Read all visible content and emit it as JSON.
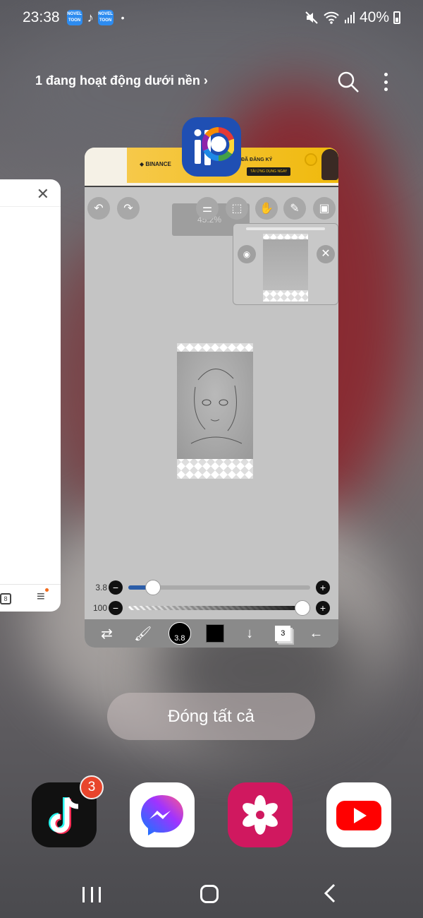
{
  "status_bar": {
    "time": "23:38",
    "notification_icons": [
      "noveltoon-icon",
      "tiktok-icon",
      "noveltoon-icon"
    ],
    "noveltoon_label": "NOVEL TOON",
    "overflow_dot": "•",
    "battery": "40%",
    "system_icons": [
      "mute-icon",
      "wifi-icon",
      "signal-icon",
      "battery-icon"
    ]
  },
  "header": {
    "background_activity": "1 đang hoạt động dưới nền",
    "chevron": "›"
  },
  "recent_apps": {
    "left_card": {
      "close": "✕"
    },
    "main_card": {
      "app": "ibis Paint X",
      "ad": {
        "brand": "◆ BINANCE",
        "headline": "ĐÃ ĐĂNG KÝ",
        "button": "TẢI ỨNG DỤNG NGAY"
      },
      "zoom": "45.2%",
      "size_label": "3.8",
      "size_value": 0.1,
      "opacity_label": "100",
      "opacity_value": 1.0,
      "brush_size": "3.8",
      "layer_count": "3",
      "minus": "−",
      "plus": "+"
    }
  },
  "close_all_label": "Đóng tất cả",
  "dock": {
    "apps": [
      "TikTok",
      "Messenger",
      "Gallery",
      "YouTube"
    ],
    "tiktok_badge": "3"
  },
  "colors": {
    "ibis_blue": "#1f4fb3",
    "binance_yellow": "#f0b90b",
    "gallery_pink": "#d0185f",
    "youtube_red": "#ff0000",
    "badge_red": "#e8452c"
  }
}
